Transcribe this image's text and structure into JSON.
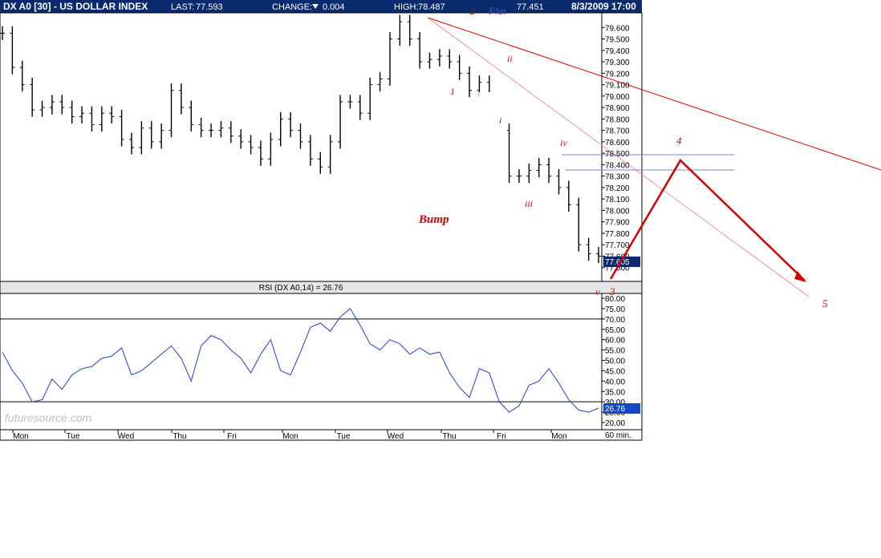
{
  "header": {
    "symbol": "DX A0 [30] - US DOLLAR INDEX",
    "last_label": "LAST:",
    "last_value": "77.593",
    "change_label": "CHANGE:",
    "change_value": "0.004",
    "high_label": "HIGH:",
    "high_value": "78.487",
    "low_value": "77.451",
    "datetime": "8/3/2009 17:00"
  },
  "price_axis": {
    "ticks": [
      "79.600",
      "79.500",
      "79.400",
      "79.300",
      "79.200",
      "79.100",
      "79.000",
      "78.900",
      "78.800",
      "78.700",
      "78.600",
      "78.500",
      "78.400",
      "78.300",
      "78.200",
      "78.100",
      "78.000",
      "77.900",
      "77.800",
      "77.700",
      "77.600",
      "77.500"
    ],
    "last_tag": "77.605"
  },
  "rsi": {
    "title": "RSI (DX A0,14) = 26.76",
    "ticks": [
      "80.00",
      "75.00",
      "70.00",
      "65.00",
      "60.00",
      "55.00",
      "50.00",
      "45.00",
      "40.00",
      "35.00",
      "30.00",
      "25.00",
      "20.00"
    ],
    "value_tag": "26.76",
    "levels": [
      70,
      30
    ]
  },
  "x_axis": {
    "days": [
      "Mon",
      "Tue",
      "Wed",
      "Thu",
      "Fri",
      "Mon",
      "Tue",
      "Wed",
      "Thu",
      "Fri",
      "Mon"
    ],
    "interval": "60 min."
  },
  "watermark": "futuresource.com",
  "annotations": {
    "wave_1": "1",
    "wave_2": "2",
    "flat": "Flat",
    "wave_i": "i",
    "wave_ii": "ii",
    "wave_iii": "iii",
    "wave_iv": "iv",
    "wave_v": "v",
    "wave_3": "3",
    "wave_4": "4",
    "wave_5": "5",
    "bump": "Bump"
  },
  "colors": {
    "header_bg": "#0a2a6e",
    "price_tag_bg": "#0a2a6e",
    "rsi_tag_bg": "#1448c8",
    "candle": "#000000",
    "rsi_line": "#1f3fc8",
    "annotation": "#d40000",
    "flat_text": "#3a5fcd"
  },
  "chart_data": {
    "type": "line",
    "title": "DX A0 [30] - US DOLLAR INDEX",
    "xlabel": "",
    "ylabel": "",
    "x": [
      "Mon",
      "Tue",
      "Wed",
      "Thu",
      "Fri",
      "Mon",
      "Tue",
      "Wed",
      "Thu",
      "Fri",
      "Mon"
    ],
    "ylim": [
      77.4,
      79.7
    ],
    "series": [
      {
        "values": [
          79.55,
          79.25,
          79.1,
          78.88,
          78.9,
          78.95,
          78.9,
          78.82,
          78.85,
          78.75,
          78.85,
          78.82,
          78.62,
          78.55,
          78.72,
          78.6,
          78.7,
          79.05,
          78.9,
          78.75,
          78.7,
          78.7,
          78.72,
          78.65,
          78.6,
          78.55,
          78.45,
          78.62,
          78.8,
          78.7,
          78.6,
          78.45,
          78.38,
          78.6,
          78.95,
          78.95,
          78.85,
          79.1,
          79.15,
          79.5,
          79.65,
          79.5,
          79.3,
          79.32,
          79.35,
          79.3,
          79.2,
          79.05,
          79.12,
          78.95,
          78.7,
          78.3,
          78.3,
          78.35,
          78.4,
          78.3,
          78.2,
          78.05,
          77.7,
          77.62,
          77.6
        ]
      },
      {
        "name": "RSI (DX A0,14)",
        "values": [
          54,
          45,
          39,
          30,
          31,
          41,
          36,
          43,
          46,
          47,
          51,
          52,
          56,
          43,
          45,
          49,
          53,
          57,
          51,
          40,
          57,
          62,
          60,
          55,
          51,
          44,
          53,
          60,
          45,
          43,
          54,
          66,
          68,
          64,
          71,
          75,
          67,
          58,
          55,
          60,
          58,
          53,
          56,
          53,
          54,
          44,
          37,
          32,
          46,
          44,
          30,
          25,
          28,
          38,
          40,
          46,
          39,
          31,
          26,
          25,
          27
        ]
      }
    ],
    "rsi_ylim": [
      20,
      80
    ],
    "rsi_levels": [
      70,
      30
    ],
    "price_ticks": [
      79.6,
      79.5,
      79.4,
      79.3,
      79.2,
      79.1,
      79.0,
      78.9,
      78.8,
      78.7,
      78.6,
      78.5,
      78.4,
      78.3,
      78.2,
      78.1,
      78.0,
      77.9,
      77.8,
      77.7,
      77.6,
      77.5
    ],
    "rsi_ticks": [
      80,
      75,
      70,
      65,
      60,
      55,
      50,
      45,
      40,
      35,
      30,
      25,
      20
    ],
    "last_price": 77.605,
    "last_rsi": 26.76
  }
}
